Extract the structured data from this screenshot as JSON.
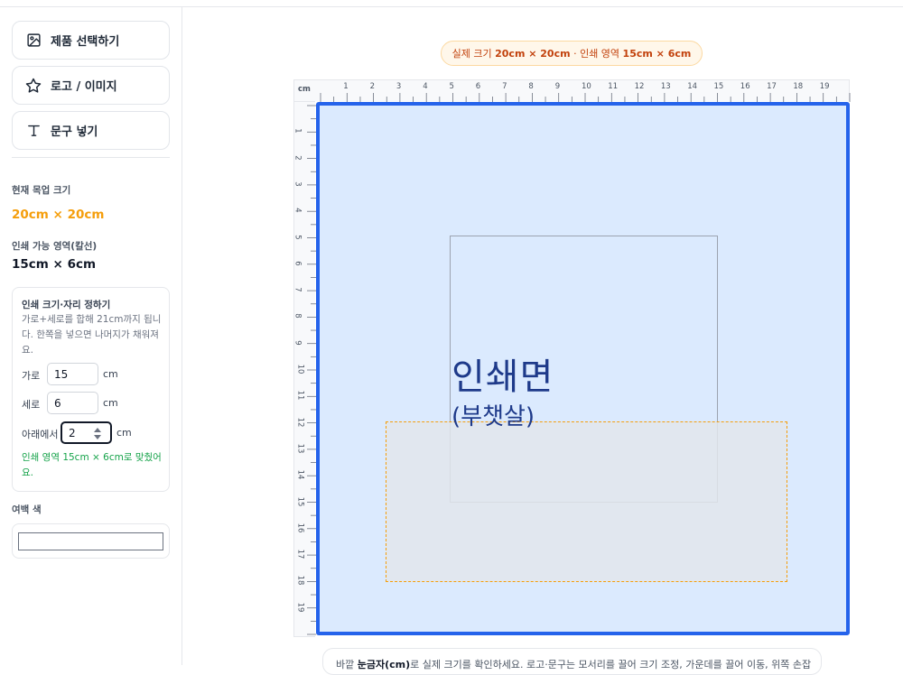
{
  "sidebar": {
    "tools": [
      {
        "label": "제품 선택하기",
        "icon": "image-icon"
      },
      {
        "label": "로고 / 이미지",
        "icon": "star-icon"
      },
      {
        "label": "문구 넣기",
        "icon": "text-icon"
      }
    ],
    "mockup_size_label": "현재 목업 크기",
    "mockup_size_value": "20cm × 20cm",
    "printable_label": "인쇄 가능 영역(칼선)",
    "printable_value": "15cm × 6cm",
    "panel": {
      "title": "인쇄 크기·자리 정하기",
      "desc": "가로+세로를 합해 21cm까지 됩니다. 한쪽을 넣으면 나머지가 채워져요.",
      "width_label": "가로",
      "width_value": "15",
      "height_label": "세로",
      "height_value": "6",
      "bottom_label": "아래에서",
      "bottom_value": "2",
      "unit": "cm",
      "ok_message": "인쇄 영역 15cm × 6cm로 맞췄어요."
    },
    "margin_color_label": "여백 색"
  },
  "main": {
    "size_pill_prefix": "실제 크기 ",
    "size_pill_real": "20cm × 20cm",
    "size_pill_mid": " · 인쇄 영역 ",
    "size_pill_area": "15cm × 6cm",
    "ruler_unit": "cm",
    "ruler_top_ticks": [
      "1",
      "2",
      "3",
      "4",
      "5",
      "6",
      "7",
      "8",
      "9",
      "10",
      "11",
      "12",
      "13",
      "14",
      "15",
      "16",
      "17",
      "18",
      "19"
    ],
    "ruler_left_ticks": [
      "1",
      "2",
      "3",
      "4",
      "5",
      "6",
      "7",
      "8",
      "9",
      "10",
      "11",
      "12",
      "13",
      "14",
      "15",
      "16",
      "17",
      "18",
      "19"
    ],
    "face_title": "인쇄면",
    "face_subtitle": "(부챗살)",
    "hint_prefix": "바깥 ",
    "hint_bold": "눈금자(cm)",
    "hint_suffix": "로 실제 크기를 확인하세요. 로고·문구는 모서리를 끌어 크기 조정, 가운데를 끌어 이동, 위쪽 손잡"
  },
  "colors": {
    "accent": "#2563eb",
    "orange": "#f59e0b",
    "success": "#16a34a"
  }
}
